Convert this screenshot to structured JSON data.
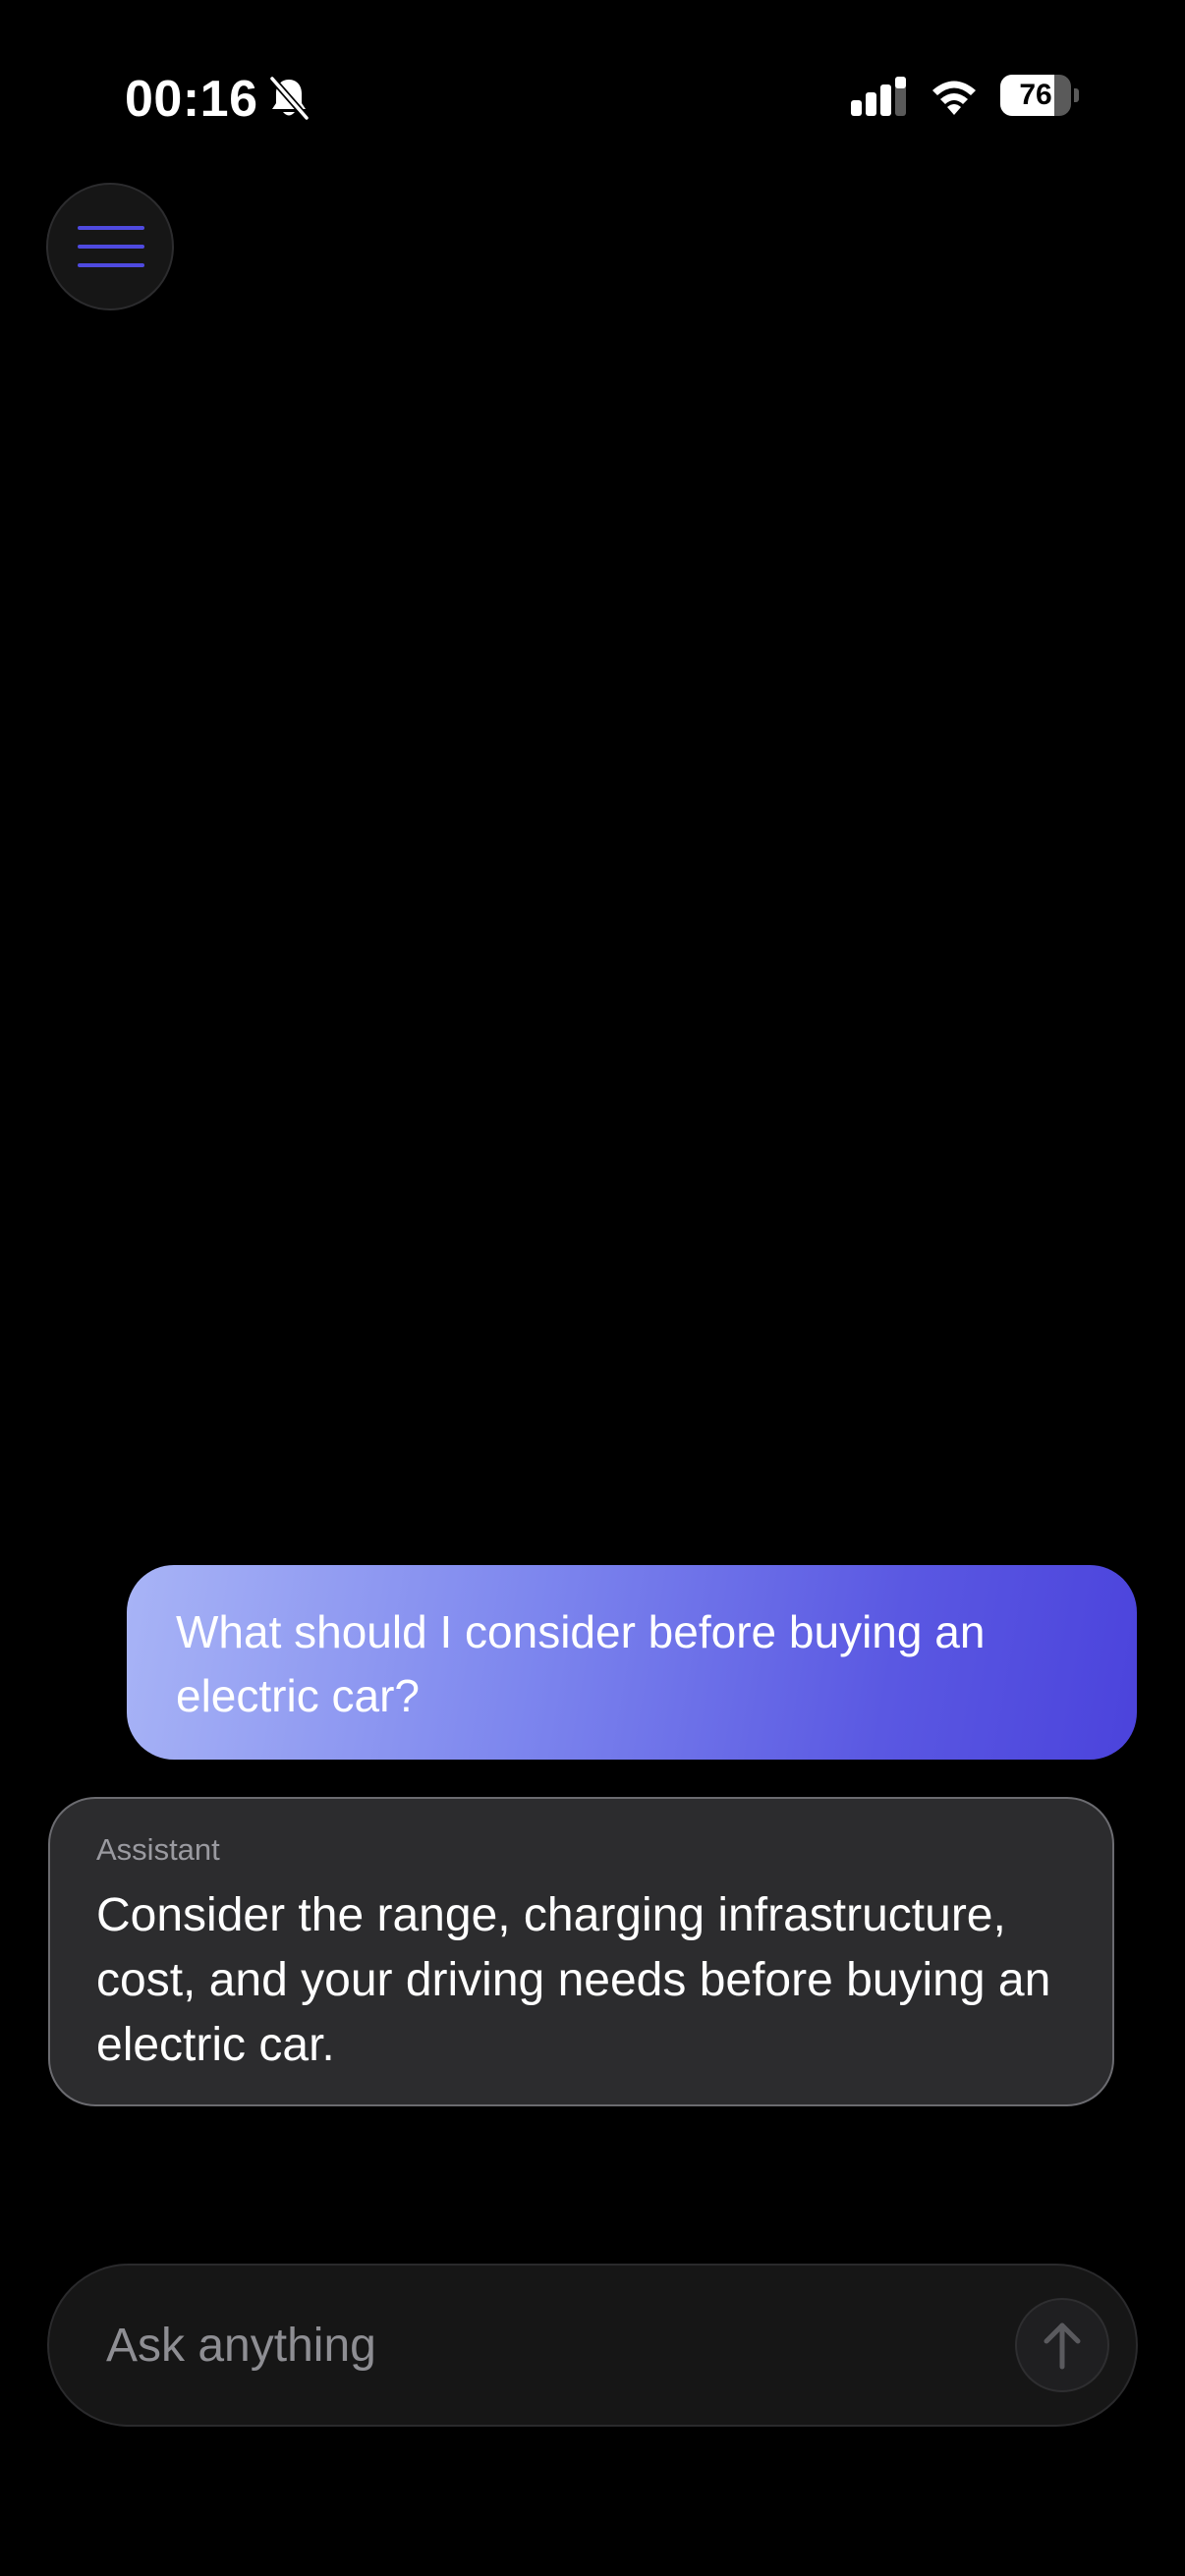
{
  "status_bar": {
    "time": "00:16",
    "battery_percent": "76",
    "battery_level": 0.76,
    "icons": [
      "bell-slash-icon",
      "cellular-signal-icon",
      "wifi-icon",
      "battery-icon"
    ]
  },
  "header": {
    "menu_icon": "hamburger-menu-icon",
    "menu_icon_color": "#4f4ae0"
  },
  "conversation": {
    "messages": [
      {
        "role": "user",
        "text": "What should I consider before buying an electric car?"
      },
      {
        "role": "assistant",
        "label": "Assistant",
        "text": "Consider the range, charging infrastructure, cost, and your driving needs before buying an electric car."
      }
    ]
  },
  "composer": {
    "placeholder": "Ask anything",
    "value": "",
    "send_icon": "arrow-up-icon"
  },
  "colors": {
    "background": "#000000",
    "user_bubble_gradient_start": "#a8b4f6",
    "user_bubble_gradient_end": "#4b43dc",
    "assistant_bubble": "#2c2c2e",
    "accent": "#4f4ae0"
  }
}
